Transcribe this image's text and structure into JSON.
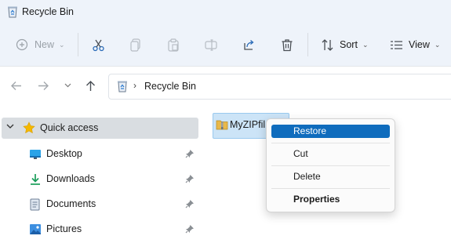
{
  "window": {
    "title": "Recycle Bin"
  },
  "toolbar": {
    "new_label": "New",
    "sort_label": "Sort",
    "view_label": "View",
    "disabled_color": "#9aa1a8",
    "icons": [
      "cut-icon",
      "copy-icon",
      "paste-icon",
      "rename-icon",
      "share-icon",
      "delete-icon"
    ]
  },
  "navigation": {
    "buttons": [
      "back-arrow-icon",
      "forward-arrow-icon",
      "recent-chevron-icon",
      "up-arrow-icon"
    ]
  },
  "address": {
    "crumb": "Recycle Bin"
  },
  "sidebar": {
    "quick_access": "Quick access",
    "items": [
      {
        "label": "Desktop",
        "icon": "desktop-icon"
      },
      {
        "label": "Downloads",
        "icon": "download-icon"
      },
      {
        "label": "Documents",
        "icon": "documents-icon"
      },
      {
        "label": "Pictures",
        "icon": "pictures-icon"
      }
    ]
  },
  "files": [
    {
      "name": "MyZIPfil",
      "icon": "zip-folder-icon",
      "selected": true
    }
  ],
  "context_menu": {
    "items": [
      {
        "label": "Restore",
        "highlighted": true
      },
      {
        "label": "Cut"
      },
      {
        "label": "Delete"
      },
      {
        "label": "Properties",
        "bold": true
      }
    ],
    "highlight_color": "#0f6cbd"
  }
}
